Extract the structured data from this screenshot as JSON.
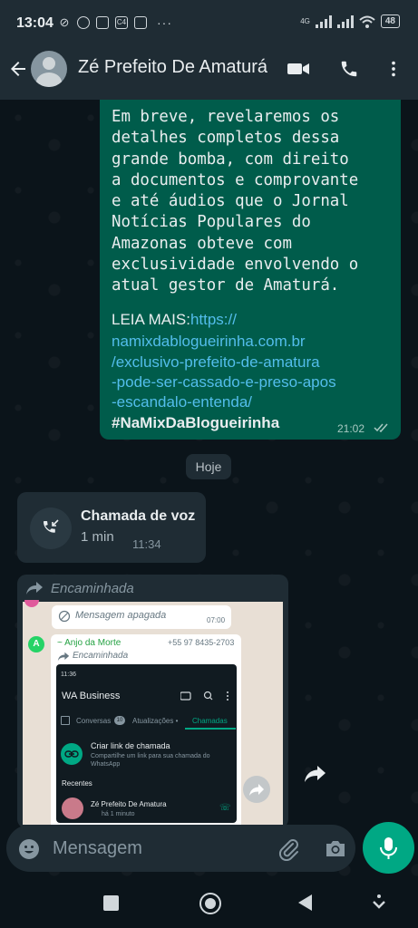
{
  "status_bar": {
    "time": "13:04",
    "battery": "48",
    "network": "4G",
    "more": "···",
    "ic_c4": "C4"
  },
  "header": {
    "contact_name": "Zé Prefeito De Amaturá"
  },
  "message": {
    "body": "Em breve, revelaremos os\ndetalhes completos dessa\ngrande bomba, com direito\na documentos e comprovante\ne até áudios que o Jornal\nNotícias Populares do\nAmazonas obteve com\nexclusividade envolvendo o\natual gestor de Amaturá.",
    "read_more_label": "LEIA MAIS:",
    "link_lines": [
      "https://",
      "namixdablogueirinha.com.br",
      "/exclusivo-prefeito-de-amatura",
      "-pode-ser-cassado-e-preso-apos",
      "-escandalo-entenda/"
    ],
    "hashtag": "#NaMixDaBlogueirinha",
    "time": "21:02"
  },
  "date_chip": "Hoje",
  "call": {
    "title": "Chamada de voz",
    "duration": "1 min",
    "time": "11:34"
  },
  "forwarded": {
    "label": "Encaminhada",
    "screenshot": {
      "deleted_text": "Mensagem apagada",
      "deleted_time": "07:00",
      "avatar_letter": "A",
      "sender": "~ Anjo da Morte",
      "phone": "+55 97 8435-2703",
      "forwarded": "Encaminhada",
      "phone_time": "11:36",
      "app_title": "WA Business",
      "tabs": [
        "Conversas",
        "Atualizações •",
        "Chamadas"
      ],
      "badge": "10",
      "create_link_title": "Criar link de chamada",
      "create_link_sub": "Compartilhe um link para sua chamada do WhatsApp",
      "recent": "Recentes",
      "contact": "Zé Prefeito De Amatura",
      "contact_time": "há 1 minuto"
    }
  },
  "composer": {
    "placeholder": "Mensagem"
  },
  "colors": {
    "outgoing": "#005c4b",
    "incoming": "#1f2c34",
    "accent": "#00a884",
    "link": "#53bdeb"
  }
}
